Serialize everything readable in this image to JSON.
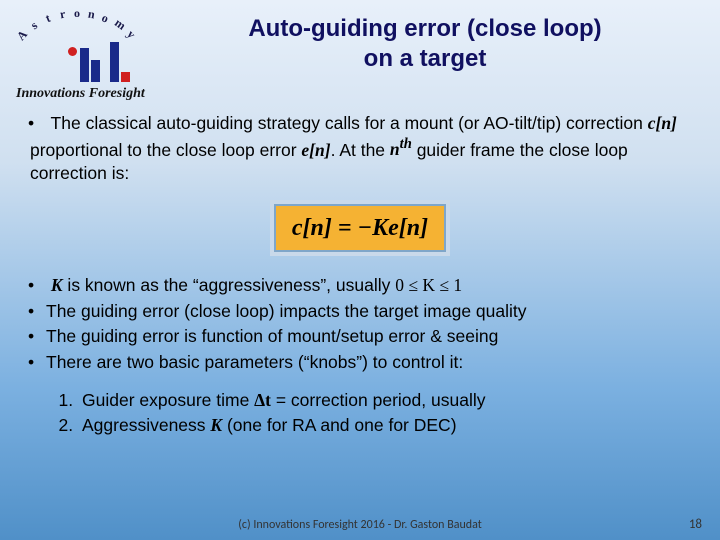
{
  "header": {
    "arc_letters": [
      "A",
      "s",
      "t",
      "r",
      "o",
      "n",
      "o",
      "m",
      "y"
    ],
    "logo_caption": "Innovations Foresight",
    "title_line1": "Auto-guiding error (close loop)",
    "title_line2": "on a target"
  },
  "body": {
    "p1_a": "The classical auto-guiding strategy calls for a mount (or AO-tilt/tip) correction ",
    "p1_c": "c[n]",
    "p1_b": " proportional to the close loop error ",
    "p1_e": "e[n]",
    "p1_d": ". At the ",
    "p1_n": "n",
    "p1_th": "th",
    "p1_f": " guider frame the close loop correction is:",
    "equation": "c[n] = −Ke[n]",
    "p2_K": "K",
    "p2_a": " is known as the “aggressiveness”, usually ",
    "p2_r": "0 ≤ K ≤ 1",
    "p3": "The guiding error (close loop) impacts the target image quality",
    "p4": "The guiding error is function of mount/setup error & seeing",
    "p5": "There are two basic parameters (“knobs”) to control it:",
    "n1_a": "Guider exposure time ",
    "n1_dt": "Δt",
    "n1_b": " = correction period, usually",
    "n2_a": "Aggressiveness ",
    "n2_K": "K",
    "n2_b": " (one for RA and one for DEC)"
  },
  "footer": {
    "copyright": "(c) Innovations Foresight 2016 - Dr. Gaston Baudat",
    "page": "18"
  }
}
